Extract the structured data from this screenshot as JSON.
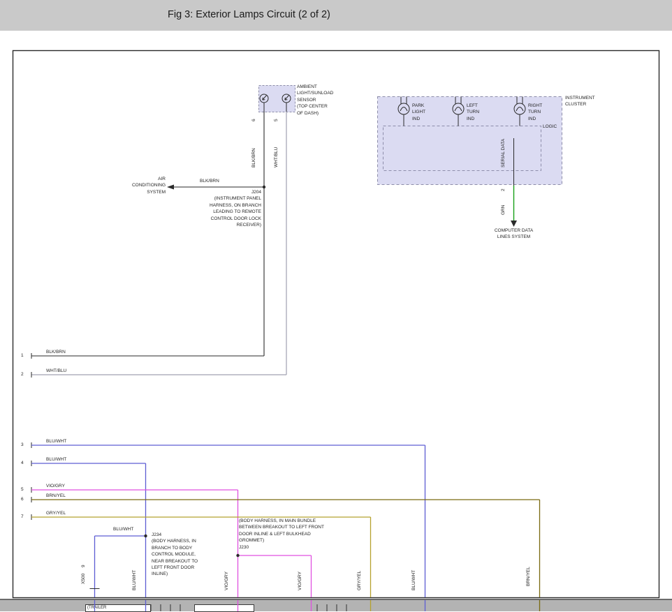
{
  "header": {
    "title": "Fig 3: Exterior Lamps Circuit (2 of 2)"
  },
  "colors": {
    "header_bg": "#c9c9c9",
    "diagram_border": "#2a2a2a",
    "box_fill": "#dbdbf2",
    "box_border": "#8d8daa",
    "wire_black": "#2a2a2a",
    "wire_white_blue": "#a0a0b0",
    "wire_blue_white": "#5d5dd3",
    "wire_violet_gray": "#e052e0",
    "wire_brown_yellow": "#7a6a10",
    "wire_gray_yellow": "#b5a22e",
    "wire_green": "#18a018"
  },
  "sensor": {
    "label": "AMBIENT\nLIGHT/SUNLOAD\nSENSOR\n(TOP CENTER\nOF DASH)",
    "pin_left": "6",
    "pin_right": "5",
    "wire_left": "BLK/BRN",
    "wire_right": "WHT/BLU"
  },
  "cluster": {
    "label": "INSTRUMENT\nCLUSTER",
    "park": "PARK\nLIGHT\nIND",
    "left_turn": "LEFT\nTURN\nIND",
    "right_turn": "RIGHT\nTURN\nIND",
    "logic": "LOGIC",
    "serial": "SERIAL DATA",
    "pin": "2",
    "wire": "GRN",
    "dest": "COMPUTER DATA\nLINES SYSTEM"
  },
  "ac": {
    "label": "AIR\nCONDITIONING\nSYSTEM",
    "wire": "BLK/BRN",
    "splice": "J204\n(INSTRUMENT PANEL\nHARNESS, ON BRANCH\nLEADING TO REMOTE\nCONTROL DOOR LOCK\nRECEIVER)"
  },
  "left_pins": [
    {
      "n": "1",
      "wire": "BLK/BRN"
    },
    {
      "n": "2",
      "wire": "WHT/BLU"
    },
    {
      "n": "3",
      "wire": "BLU/WHT"
    },
    {
      "n": "4",
      "wire": "BLU/WHT"
    },
    {
      "n": "5",
      "wire": "VIO/GRY"
    },
    {
      "n": "6",
      "wire": "BRN/YEL"
    },
    {
      "n": "7",
      "wire": "GRY/YEL"
    }
  ],
  "j234": {
    "branch_wire": "BLU/WHT",
    "text": "J234\n(BODY HARNESS, IN\nBRANCH TO BODY\nCONTROL MODULE,\nNEAR BREAKOUT TO\nLEFT FRONT DOOR\nINLINE)",
    "connector": "X500",
    "connector_pin": "9"
  },
  "j230": {
    "text": "(BODY HARNESS, IN MAIN BUNDLE\nBETWEEN BREAKOUT TO LEFT FRONT\nDOOR INLINE & LEFT BULKHEAD\nGROMMET)\nJ230"
  },
  "bottom_wires": [
    "BLU/WHT",
    "VIO/GRY",
    "VIO/GRY",
    "GRY/YEL",
    "BLU/WHT",
    "BRN/YEL"
  ],
  "bottom_strip": {
    "fragment1": "(TRAILER",
    "fragment2": ""
  }
}
